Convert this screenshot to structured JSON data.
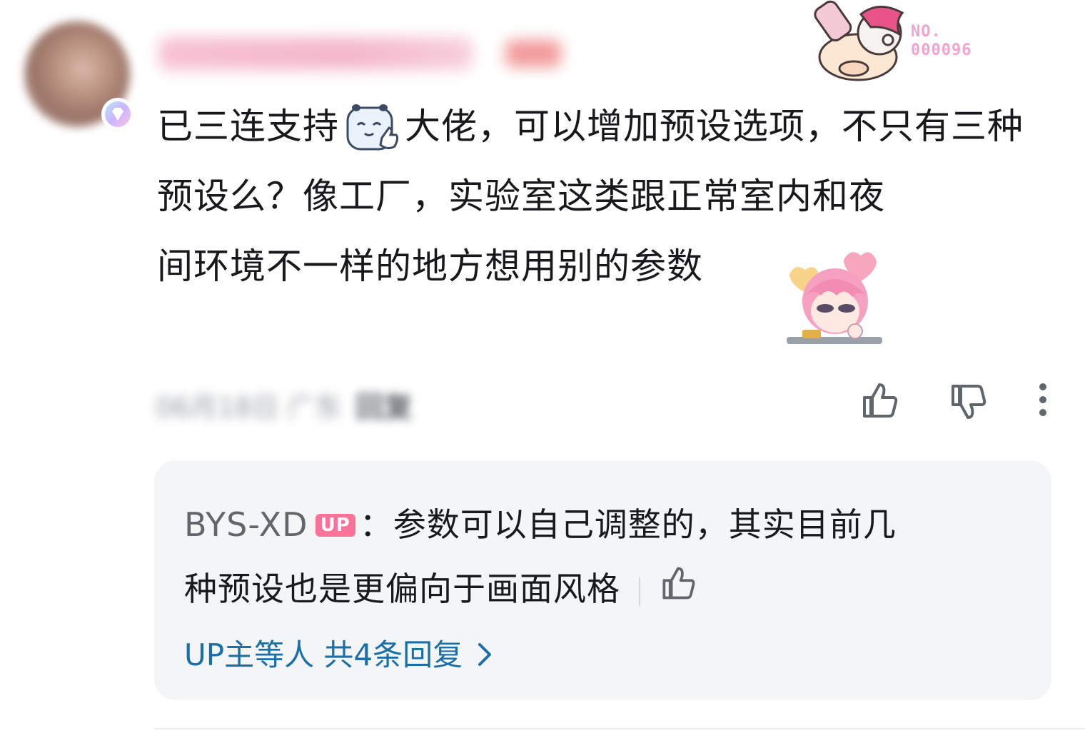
{
  "comment": {
    "badge_no": "NO.",
    "badge_number": "000096",
    "text_part1": "已三连支持",
    "text_part2": "大佬，可以增加预设选项，不只有三种预设么？像工厂，实验室这类跟正常室内和夜",
    "text_part3": "间环境不一样的地方想用别的参数",
    "inline_emote": "thumbs-up-panda-emote",
    "sticker": "pink-hair-girl-sticker",
    "actions": {
      "like_icon": "thumb-up-icon",
      "dislike_icon": "thumb-down-icon",
      "more_icon": "more-vertical-icon"
    }
  },
  "reply_preview": {
    "username": "BYS-XD",
    "up_badge": "UP",
    "separator": "：",
    "text_line1": "参数可以自己调整的，其实目前几",
    "text_line2": "种预设也是更偏向于画面风格",
    "like_icon": "thumb-up-icon",
    "more_replies": "UP主等人 共4条回复",
    "chevron_icon": "chevron-right-icon"
  },
  "colors": {
    "text_primary": "#18191c",
    "text_secondary": "#61666d",
    "link_blue": "#1a6fa8",
    "up_pink": "#fb7299",
    "card_bg": "#f4f5f7",
    "icon_gray": "#61666d"
  }
}
